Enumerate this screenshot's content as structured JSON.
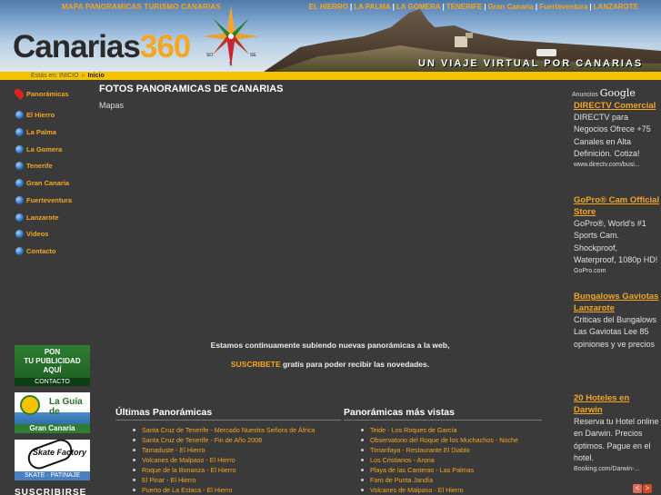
{
  "header": {
    "top_link": "MAPA PANORAMICAS TURISMO CANARIAS",
    "islands": [
      "EL HIERRO",
      "LA PALMA",
      "LA GOMERA",
      "TENERIFE",
      "Gran Canaria",
      "Fuerteventura",
      "LANZAROTE"
    ],
    "separator": "|",
    "logo_text": "Canarias",
    "logo_num": "360",
    "compass_marks": [
      "SO",
      "S",
      "SE"
    ],
    "tagline": "UN VIAJE VIRTUAL POR CANARIAS"
  },
  "breadcrumb": {
    "link": "Estás en: INICIO",
    "sep": "»",
    "current": "Inicio"
  },
  "sidebar": {
    "items": [
      {
        "label": "Panorámicas",
        "icon": "map-pin-icon"
      },
      {
        "label": "El Hierro",
        "icon": "globe-icon"
      },
      {
        "label": "La Palma",
        "icon": "globe-icon"
      },
      {
        "label": "La Gomera",
        "icon": "globe-icon"
      },
      {
        "label": "Tenerife",
        "icon": "globe-icon"
      },
      {
        "label": "Gran Canaria",
        "icon": "globe-icon"
      },
      {
        "label": "Fuerteventura",
        "icon": "globe-icon"
      },
      {
        "label": "Lanzarote",
        "icon": "globe-icon"
      },
      {
        "label": "Videos",
        "icon": "globe-icon"
      },
      {
        "label": "Contacto",
        "icon": "globe-icon"
      }
    ],
    "ads": {
      "ad1_line1": "PON",
      "ad1_line2": "TU PUBLICIDAD",
      "ad1_line3": "AQUÍ",
      "ad1_footer": "CONTACTO",
      "ad2_title": "La Guía de",
      "ad2_footer": "Gran Canaria",
      "ad3_title": "Skate Factory",
      "ad3_footer": "SKATE · PATINAJE"
    },
    "subscribe": "SUSCRIBIRSE"
  },
  "main": {
    "title": "FOTOS PANORAMICAS DE CANARIAS",
    "subtitle": "Mapas",
    "notice_line1": "Estamos continuamente subiendo nuevas panorámicas a la web,",
    "notice_link": "SUSCRIBETE",
    "notice_line2": " gratis para poder recibir las novedades.",
    "latest_heading": "Últimas Panorámicas",
    "latest": [
      "Santa Cruz de Tenerife - Mercado Nuestra Señora de África",
      "Santa Cruz de Tenerife - Fin de Año 2008",
      "Tamaduste - El Hierro",
      "Volcanes de Malpaso - El Hierro",
      "Roque de la Bonanza - El Hierro",
      "El Pinar - El Hierro",
      "Puerto de La Estaca - El Hierro"
    ],
    "popular_heading": "Panorámicas más vistas",
    "popular": [
      "Teide - Los Roques de García",
      "Observatorio del Roque de los Muchachos - Noche",
      "Timanfaya - Restaurante El Diablo",
      "Los Cristianos - Arona",
      "Playa de las Canteras - Las Palmas",
      "Faro de Punta Jandía",
      "Volcanes de Malpaso - El Hierro"
    ]
  },
  "ads": {
    "label": "Anuncios",
    "brand": "Google",
    "items": [
      {
        "title": "DIRECTV Comercial",
        "desc": "DIRECTV para Negocios Ofrece +75 Canales en Alta Definición. Cotiza!",
        "url": "www.directv.com/busi..."
      },
      {
        "title": "GoPro® Cam Official Store",
        "desc": "GoPro®, World's #1 Sports Cam. Shockproof, Waterproof, 1080p HD!",
        "url": "GoPro.com"
      },
      {
        "title": "Bungalows Gaviotas Lanzarote",
        "desc": "Criticas del Bungalows Las Gaviotas Lee 85 opiniones y ve precios",
        "url": ""
      },
      {
        "title": "20 Hoteles en Darwin",
        "desc": "Reserva tu Hotel online en Darwin. Precios óptimos. Pague en el hotel.",
        "url": "Booking.com/Darwin-..."
      }
    ],
    "prev": "<",
    "next": ">"
  },
  "colors": {
    "accent": "#f5a623",
    "bar": "#f7c300",
    "background": "#3a3a3a"
  }
}
